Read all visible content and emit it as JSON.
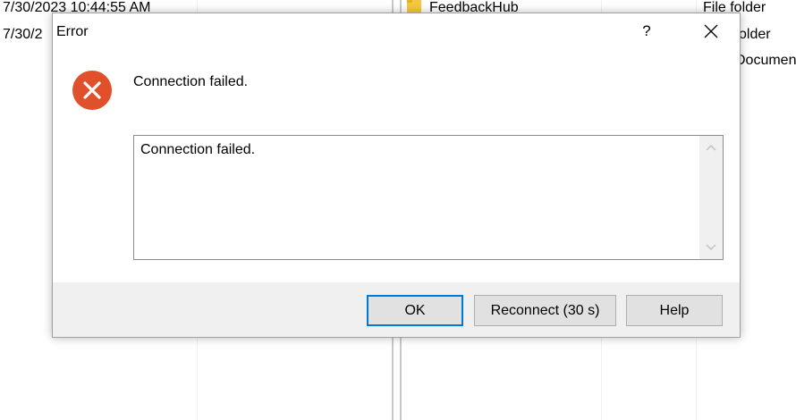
{
  "background": {
    "date_rows": [
      "7/30/2023 10:44:55 AM",
      "7/30/2"
    ],
    "file_rows": [
      {
        "name": "FeedbackHub",
        "type": "File folder"
      },
      {
        "type": "older"
      },
      {
        "type": "Documen"
      }
    ]
  },
  "dialog": {
    "title": "Error",
    "help_glyph": "?",
    "message": "Connection failed.",
    "details_text": "Connection failed.",
    "buttons": {
      "ok": "OK",
      "reconnect": "Reconnect (30 s)",
      "help": "Help"
    },
    "icon": "error-icon",
    "colors": {
      "error_icon": "#e0502a",
      "default_button_border": "#0078d7",
      "footer_bg": "#f0f0f0"
    }
  }
}
